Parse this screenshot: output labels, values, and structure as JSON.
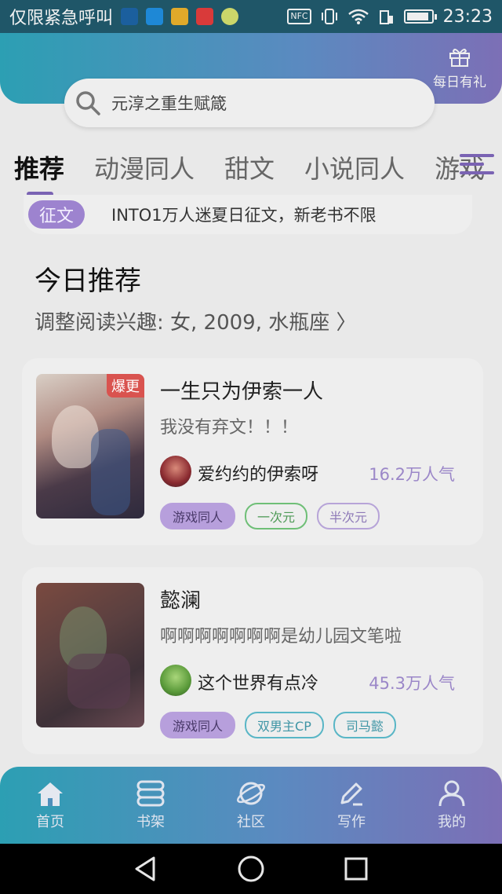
{
  "status_bar": {
    "carrier_text": "仅限紧急呼叫",
    "nfc_label": "NFC",
    "time": "23:23",
    "notification_icons": [
      "lua-app-icon",
      "play-icon",
      "folder-app-icon",
      "music-icon",
      "chat-app-icon"
    ]
  },
  "header": {
    "gift_label": "每日有礼",
    "search_text": "元淳之重生赋箴"
  },
  "tabs": [
    {
      "label": "推荐",
      "active": true
    },
    {
      "label": "动漫同人",
      "active": false
    },
    {
      "label": "甜文",
      "active": false
    },
    {
      "label": "小说同人",
      "active": false
    },
    {
      "label": "游戏",
      "active": false
    }
  ],
  "banner": {
    "tag": "征文",
    "text": "INTO1万人迷夏日征文，新老书不限"
  },
  "section": {
    "title": "今日推荐",
    "subtitle": "调整阅读兴趣: 女, 2009, 水瓶座 〉"
  },
  "books": [
    {
      "badge": "爆更",
      "title": "一生只为伊索一人",
      "desc": "我没有弃文！！！",
      "author": "爱约约的伊索呀",
      "popularity": "16.2万人气",
      "tags": [
        "游戏同人",
        "一次元",
        "半次元"
      ]
    },
    {
      "badge": "",
      "title": "懿澜",
      "desc": "啊啊啊啊啊啊啊是幼儿园文笔啦",
      "author": "这个世界有点冷",
      "popularity": "45.3万人气",
      "tags": [
        "游戏同人",
        "双男主CP",
        "司马懿"
      ]
    }
  ],
  "bottom_nav": [
    {
      "label": "首页",
      "icon": "home-icon",
      "active": true
    },
    {
      "label": "书架",
      "icon": "bookshelf-icon",
      "active": false
    },
    {
      "label": "社区",
      "icon": "planet-icon",
      "active": false
    },
    {
      "label": "写作",
      "icon": "pen-icon",
      "active": false
    },
    {
      "label": "我的",
      "icon": "user-icon",
      "active": false
    }
  ],
  "colors": {
    "accent": "#7a63b3",
    "header_start": "#2c9fb3",
    "header_end": "#7c6fb6",
    "popularity": "#9b87c8"
  }
}
